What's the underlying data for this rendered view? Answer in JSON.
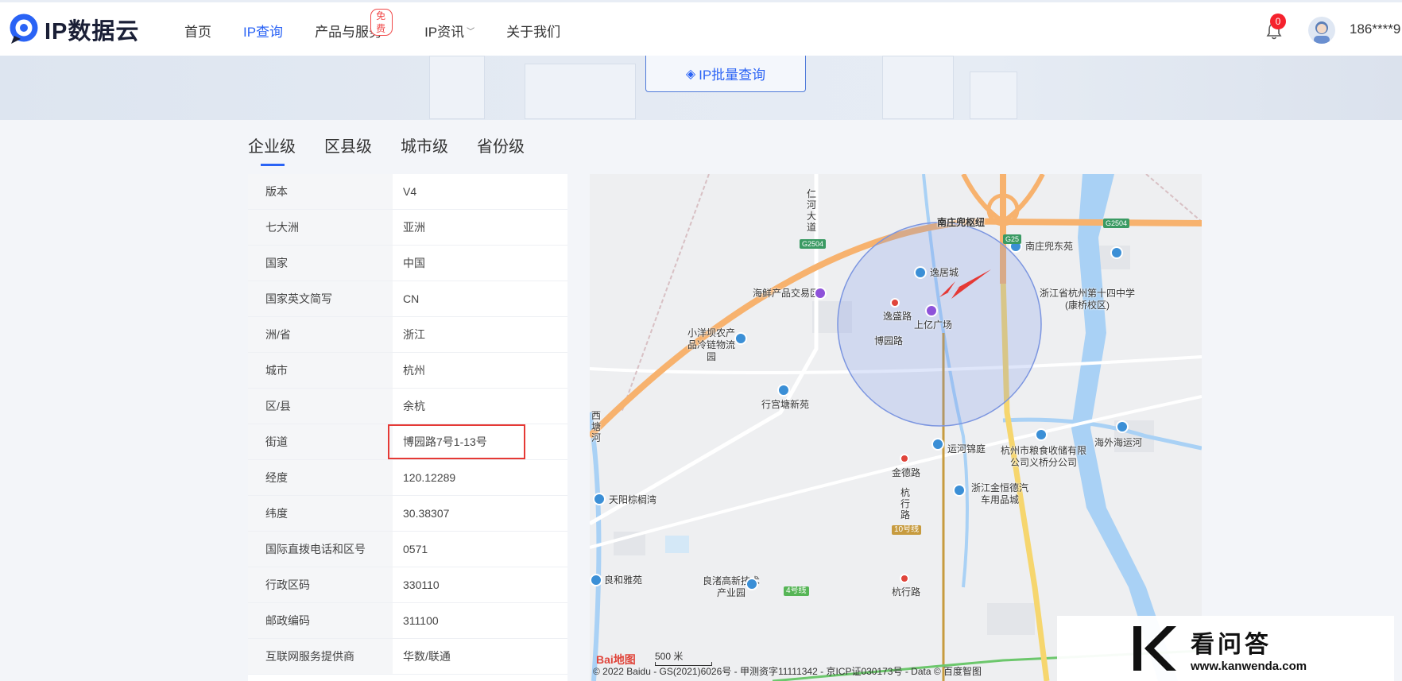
{
  "header": {
    "logo_text": "IP数据云",
    "nav": [
      {
        "label": "首页"
      },
      {
        "label": "IP查询"
      },
      {
        "label": "产品与服务"
      },
      {
        "label": "IP资讯"
      },
      {
        "label": "关于我们"
      }
    ],
    "free_badge": "免费",
    "notification_count": "0",
    "user_name": "186****9"
  },
  "banner": {
    "batch_button": "IP批量查询"
  },
  "tabs": [
    {
      "label": "企业级"
    },
    {
      "label": "区县级"
    },
    {
      "label": "城市级"
    },
    {
      "label": "省份级"
    }
  ],
  "info_rows": [
    {
      "key": "版本",
      "value": "V4"
    },
    {
      "key": "七大洲",
      "value": "亚洲"
    },
    {
      "key": "国家",
      "value": "中国"
    },
    {
      "key": "国家英文简写",
      "value": "CN"
    },
    {
      "key": "洲/省",
      "value": "浙江"
    },
    {
      "key": "城市",
      "value": "杭州"
    },
    {
      "key": "区/县",
      "value": "余杭"
    },
    {
      "key": "街道",
      "value": "博园路7号1-13号"
    },
    {
      "key": "经度",
      "value": "120.12289"
    },
    {
      "key": "纬度",
      "value": "30.38307"
    },
    {
      "key": "国际直拨电话和区号",
      "value": "0571"
    },
    {
      "key": "行政区码",
      "value": "330110"
    },
    {
      "key": "邮政编码",
      "value": "311100"
    },
    {
      "key": "互联网服务提供商",
      "value": "华数/联通"
    }
  ],
  "map": {
    "labels": {
      "renhe": "仁河大道",
      "nanzhuang_hub": "南庄兜枢纽",
      "nanzhuang_east": "南庄兜东苑",
      "yiju": "逸居城",
      "seafood": "海鲜产品交易区",
      "zhejiang_school": "浙江省杭州第十四中学(康桥校区)",
      "yisheng_road": "逸盛路",
      "shangyi": "上亿广场",
      "boyuan": "博园路",
      "xiaoyangba": "小洋坝农产品冷链物流园",
      "xinggongtang": "行宫塘新苑",
      "xitang_river": "西塘河",
      "yunhe": "运河锦庭",
      "grain": "杭州市粮食收储有限公司义桥分公司",
      "haiwai": "海外海运河",
      "jinde": "金德路",
      "hangxing_v": "杭行路",
      "hengde": "浙江金恒德汽车用品城",
      "tianyang": "天阳棕榈湾",
      "line10": "10号线",
      "liangzhu_tech": "良渚高新技术产业园",
      "lianghe": "良和雅苑",
      "line4": "4号线",
      "hangxing": "杭行路",
      "g2504_a": "G2504",
      "g2504_b": "G2504",
      "g25": "G25"
    },
    "baidu_logo": "Bai地图",
    "scale": "500 米",
    "copyright": "© 2022 Baidu - GS(2021)6026号 - 甲测资字11111342 - 京ICP证030173号 - Data © 百度智图"
  },
  "watermark": {
    "title": "看问答",
    "url": "www.kanwenda.com"
  },
  "colors": {
    "accent": "#2a63f5",
    "highlight": "#e53935",
    "road": "#f7b26e"
  }
}
